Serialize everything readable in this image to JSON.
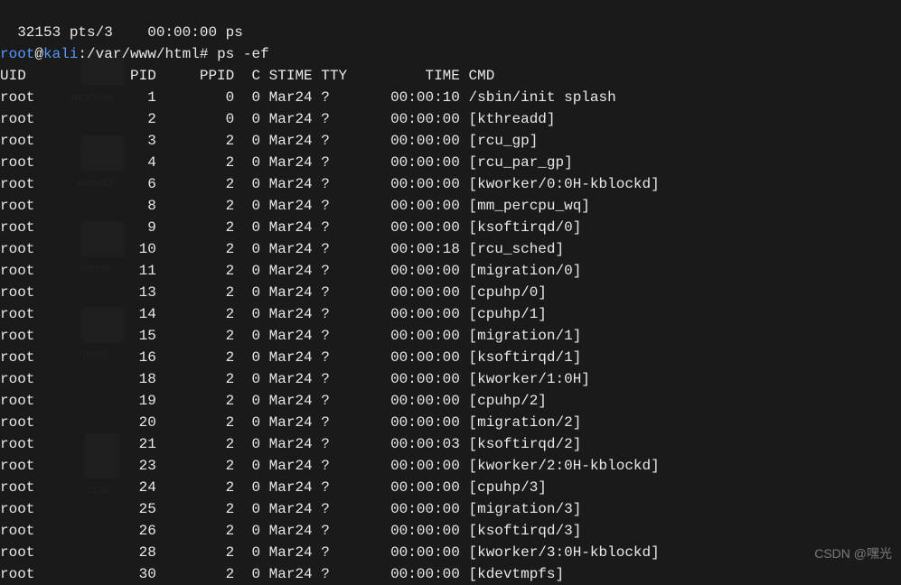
{
  "top_line": "  32153 pts/3    00:00:00 ps",
  "prompt": {
    "user": "root",
    "at": "@",
    "host": "kali",
    "sep": ":",
    "path": "/var/www/html",
    "hash": "# ",
    "command": "ps -ef"
  },
  "header": {
    "uid": "UID",
    "pid": "PID",
    "ppid": "PPID",
    "c": "C",
    "stime": "STIME",
    "tty": "TTY",
    "time": "TIME",
    "cmd": "CMD"
  },
  "rows": [
    {
      "uid": "root",
      "pid": "1",
      "ppid": "0",
      "c": "0",
      "stime": "Mar24",
      "tty": "?",
      "time": "00:00:10",
      "cmd": "/sbin/init splash"
    },
    {
      "uid": "root",
      "pid": "2",
      "ppid": "0",
      "c": "0",
      "stime": "Mar24",
      "tty": "?",
      "time": "00:00:00",
      "cmd": "[kthreadd]"
    },
    {
      "uid": "root",
      "pid": "3",
      "ppid": "2",
      "c": "0",
      "stime": "Mar24",
      "tty": "?",
      "time": "00:00:00",
      "cmd": "[rcu_gp]"
    },
    {
      "uid": "root",
      "pid": "4",
      "ppid": "2",
      "c": "0",
      "stime": "Mar24",
      "tty": "?",
      "time": "00:00:00",
      "cmd": "[rcu_par_gp]"
    },
    {
      "uid": "root",
      "pid": "6",
      "ppid": "2",
      "c": "0",
      "stime": "Mar24",
      "tty": "?",
      "time": "00:00:00",
      "cmd": "[kworker/0:0H-kblockd]"
    },
    {
      "uid": "root",
      "pid": "8",
      "ppid": "2",
      "c": "0",
      "stime": "Mar24",
      "tty": "?",
      "time": "00:00:00",
      "cmd": "[mm_percpu_wq]"
    },
    {
      "uid": "root",
      "pid": "9",
      "ppid": "2",
      "c": "0",
      "stime": "Mar24",
      "tty": "?",
      "time": "00:00:00",
      "cmd": "[ksoftirqd/0]"
    },
    {
      "uid": "root",
      "pid": "10",
      "ppid": "2",
      "c": "0",
      "stime": "Mar24",
      "tty": "?",
      "time": "00:00:18",
      "cmd": "[rcu_sched]"
    },
    {
      "uid": "root",
      "pid": "11",
      "ppid": "2",
      "c": "0",
      "stime": "Mar24",
      "tty": "?",
      "time": "00:00:00",
      "cmd": "[migration/0]"
    },
    {
      "uid": "root",
      "pid": "13",
      "ppid": "2",
      "c": "0",
      "stime": "Mar24",
      "tty": "?",
      "time": "00:00:00",
      "cmd": "[cpuhp/0]"
    },
    {
      "uid": "root",
      "pid": "14",
      "ppid": "2",
      "c": "0",
      "stime": "Mar24",
      "tty": "?",
      "time": "00:00:00",
      "cmd": "[cpuhp/1]"
    },
    {
      "uid": "root",
      "pid": "15",
      "ppid": "2",
      "c": "0",
      "stime": "Mar24",
      "tty": "?",
      "time": "00:00:00",
      "cmd": "[migration/1]"
    },
    {
      "uid": "root",
      "pid": "16",
      "ppid": "2",
      "c": "0",
      "stime": "Mar24",
      "tty": "?",
      "time": "00:00:00",
      "cmd": "[ksoftirqd/1]"
    },
    {
      "uid": "root",
      "pid": "18",
      "ppid": "2",
      "c": "0",
      "stime": "Mar24",
      "tty": "?",
      "time": "00:00:00",
      "cmd": "[kworker/1:0H]"
    },
    {
      "uid": "root",
      "pid": "19",
      "ppid": "2",
      "c": "0",
      "stime": "Mar24",
      "tty": "?",
      "time": "00:00:00",
      "cmd": "[cpuhp/2]"
    },
    {
      "uid": "root",
      "pid": "20",
      "ppid": "2",
      "c": "0",
      "stime": "Mar24",
      "tty": "?",
      "time": "00:00:00",
      "cmd": "[migration/2]"
    },
    {
      "uid": "root",
      "pid": "21",
      "ppid": "2",
      "c": "0",
      "stime": "Mar24",
      "tty": "?",
      "time": "00:00:03",
      "cmd": "[ksoftirqd/2]"
    },
    {
      "uid": "root",
      "pid": "23",
      "ppid": "2",
      "c": "0",
      "stime": "Mar24",
      "tty": "?",
      "time": "00:00:00",
      "cmd": "[kworker/2:0H-kblockd]"
    },
    {
      "uid": "root",
      "pid": "24",
      "ppid": "2",
      "c": "0",
      "stime": "Mar24",
      "tty": "?",
      "time": "00:00:00",
      "cmd": "[cpuhp/3]"
    },
    {
      "uid": "root",
      "pid": "25",
      "ppid": "2",
      "c": "0",
      "stime": "Mar24",
      "tty": "?",
      "time": "00:00:00",
      "cmd": "[migration/3]"
    },
    {
      "uid": "root",
      "pid": "26",
      "ppid": "2",
      "c": "0",
      "stime": "Mar24",
      "tty": "?",
      "time": "00:00:00",
      "cmd": "[ksoftirqd/3]"
    },
    {
      "uid": "root",
      "pid": "28",
      "ppid": "2",
      "c": "0",
      "stime": "Mar24",
      "tty": "?",
      "time": "00:00:00",
      "cmd": "[kworker/3:0H-kblockd]"
    },
    {
      "uid": "root",
      "pid": "30",
      "ppid": "2",
      "c": "0",
      "stime": "Mar24",
      "tty": "?",
      "time": "00:00:00",
      "cmd": "[kdevtmpfs]"
    }
  ],
  "watermark": "CSDN @嘿光",
  "desktop_icons": {
    "identYwat": "identYwat",
    "wafw00f": "wafw00f",
    "venom": "venom",
    "ngrok": "ngrok",
    "file12": "12.txt"
  }
}
